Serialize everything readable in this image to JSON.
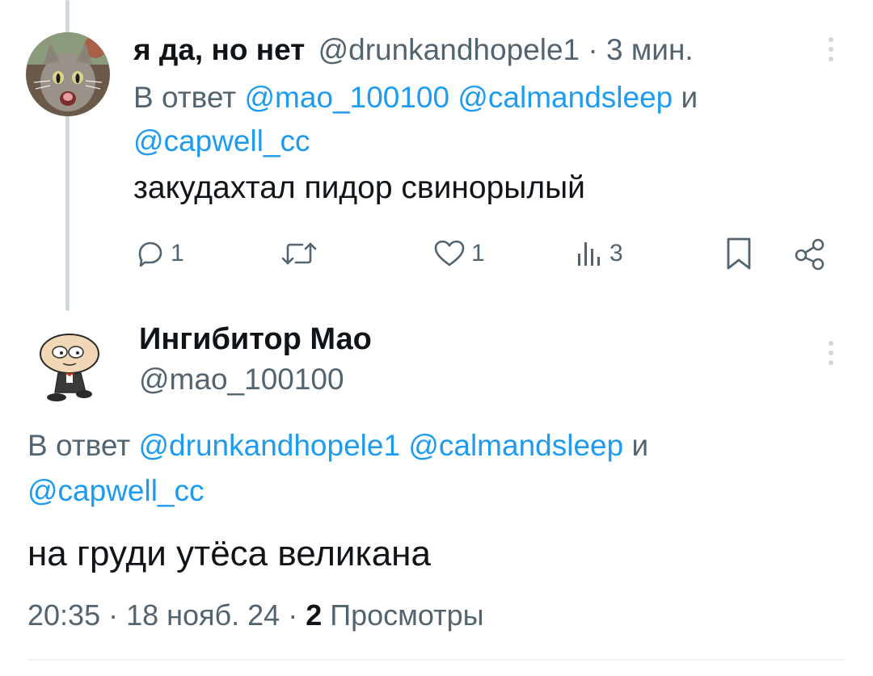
{
  "reply_tweet": {
    "display_name": "я да, но нет",
    "handle": "@drunkandhopele1",
    "separator": " · ",
    "time": "3 мин.",
    "replying_prefix": "В ответ ",
    "replying_mentions": [
      "@mao_100100",
      "@calmandsleep"
    ],
    "replying_conjunction": " и ",
    "replying_last": "@capwell_cc",
    "text": "закудахтал пидор свинорылый",
    "actions": {
      "reply_count": "1",
      "retweet_count": "",
      "like_count": "1",
      "views_count": "3"
    }
  },
  "main_tweet": {
    "display_name": "Ингибитор Мао",
    "handle": "@mao_100100",
    "replying_prefix": "В ответ ",
    "replying_mentions": [
      "@drunkandhopele1",
      "@calmandsleep"
    ],
    "replying_conjunction": " и ",
    "replying_last": "@capwell_cc",
    "text": "на груди утёса великана",
    "time": "20:35",
    "dot": " · ",
    "date": "18 нояб. 24",
    "views_count": "2",
    "views_label": " Просмотры"
  },
  "icons": {
    "reply": "reply-icon",
    "retweet": "retweet-icon",
    "like": "heart-icon",
    "views": "views-icon",
    "bookmark": "bookmark-icon",
    "share": "share-icon",
    "more": "more-vertical-icon"
  },
  "colors": {
    "accent": "#1d9bf0",
    "muted": "#536471",
    "text": "#0f1419",
    "line": "#cfd9de"
  }
}
